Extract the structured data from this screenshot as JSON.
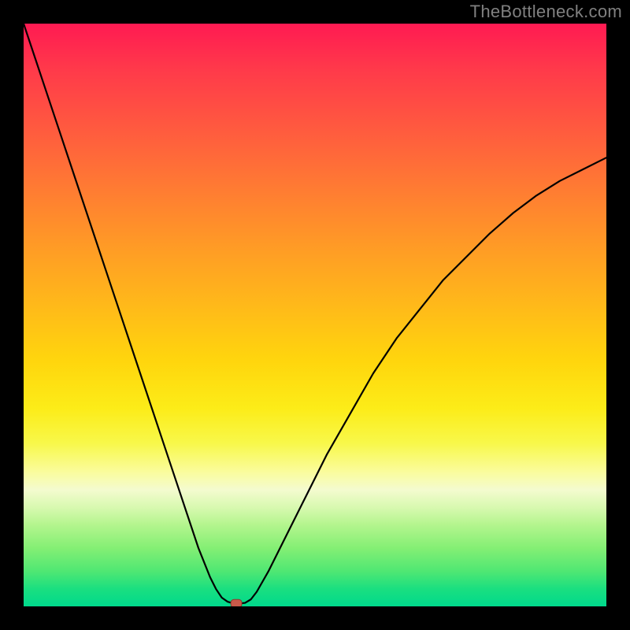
{
  "watermark": "TheBottleneck.com",
  "colors": {
    "frame": "#000000",
    "curve": "#000000",
    "marker_fill": "#c95a4a",
    "marker_stroke": "#8e3b2f",
    "gradient_stops": [
      "#ff1a52",
      "#ff3a4a",
      "#ff5a3f",
      "#ff7a33",
      "#ff9a26",
      "#ffb81a",
      "#ffd60d",
      "#fcec18",
      "#f8f84a",
      "#fafc9e",
      "#f4fbcf",
      "#d8f9b0",
      "#b4f58e",
      "#84ef74",
      "#4fe773",
      "#1adf80",
      "#00d98c"
    ]
  },
  "chart_data": {
    "type": "line",
    "title": "",
    "xlabel": "",
    "ylabel": "",
    "xlim": [
      0,
      100
    ],
    "ylim": [
      0,
      100
    ],
    "grid": false,
    "legend": false,
    "note": "Single V-shaped curve with a flat-bottom minimum near x≈36, y≈0. Values estimated from pixels at ~1% precision.",
    "series": [
      {
        "name": "curve",
        "x": [
          0,
          2,
          4,
          6,
          8,
          10,
          12,
          14,
          16,
          18,
          20,
          22,
          24,
          26,
          28,
          30,
          32,
          33,
          34,
          35,
          36,
          37,
          38,
          39,
          40,
          42,
          44,
          46,
          48,
          50,
          52,
          56,
          60,
          64,
          68,
          72,
          76,
          80,
          84,
          88,
          92,
          96,
          100
        ],
        "y": [
          100,
          94,
          88,
          82,
          76,
          70,
          64,
          58,
          52,
          46,
          40,
          34,
          28,
          22,
          16,
          10,
          5,
          3,
          1.5,
          0.8,
          0.5,
          0.5,
          0.6,
          1.2,
          2.5,
          6,
          10,
          14,
          18,
          22,
          26,
          33,
          40,
          46,
          51,
          56,
          60,
          64,
          67.5,
          70.5,
          73,
          75,
          77
        ]
      }
    ],
    "marker": {
      "x": 36.5,
      "y": 0.5,
      "shape": "rounded-rect"
    }
  }
}
